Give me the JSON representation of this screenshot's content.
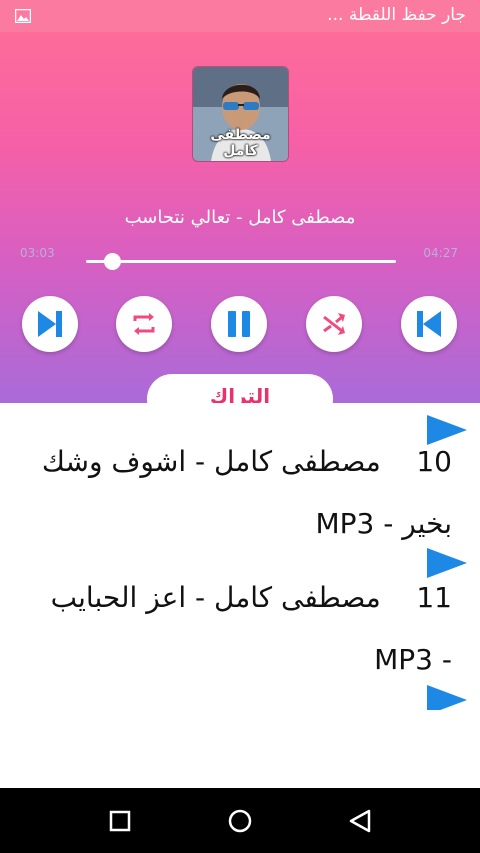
{
  "status": {
    "text": "جار حفظ اللقطة ...",
    "icon": "image-icon"
  },
  "album": {
    "caption": "مصطفى كامل"
  },
  "track": {
    "title": "مصطفى كامل - تعالي نتحاسب",
    "elapsed": "03:03",
    "duration": "04:27",
    "progress": 0.086
  },
  "controls": [
    "next-icon",
    "repeat-icon",
    "pause-icon",
    "shuffle-icon",
    "previous-icon"
  ],
  "tab": {
    "label": "التراك"
  },
  "playlist": [
    {
      "number": "10",
      "title": "مصطفى كامل - اشوف وشك بخير - MP3"
    },
    {
      "number": "11",
      "title": "مصطفى كامل - اعز الحبايب - MP3"
    }
  ],
  "colors": {
    "accent": "#1e88e5",
    "pink": "#ff6f96",
    "purple": "#a96bd8",
    "tab_text": "#e8326f"
  },
  "nav": [
    "recents-icon",
    "home-icon",
    "back-icon"
  ]
}
